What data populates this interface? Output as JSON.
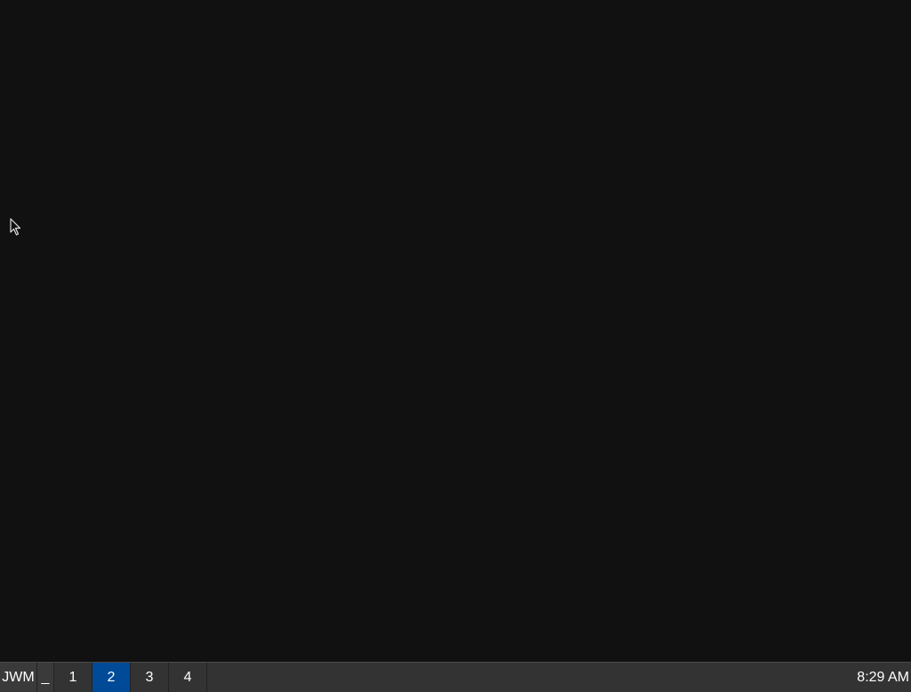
{
  "taskbar": {
    "menu_label": "JWM",
    "show_desktop_label": "_",
    "desktops": [
      {
        "label": "1",
        "active": false
      },
      {
        "label": "2",
        "active": true
      },
      {
        "label": "3",
        "active": false
      },
      {
        "label": "4",
        "active": false
      }
    ],
    "clock": "8:29 AM"
  },
  "colors": {
    "desktop_background": "#111111",
    "taskbar_background": "#333333",
    "active_desktop": "#004a97",
    "text": "#ffffff"
  },
  "cursor": {
    "icon": "mouse-pointer-icon"
  }
}
